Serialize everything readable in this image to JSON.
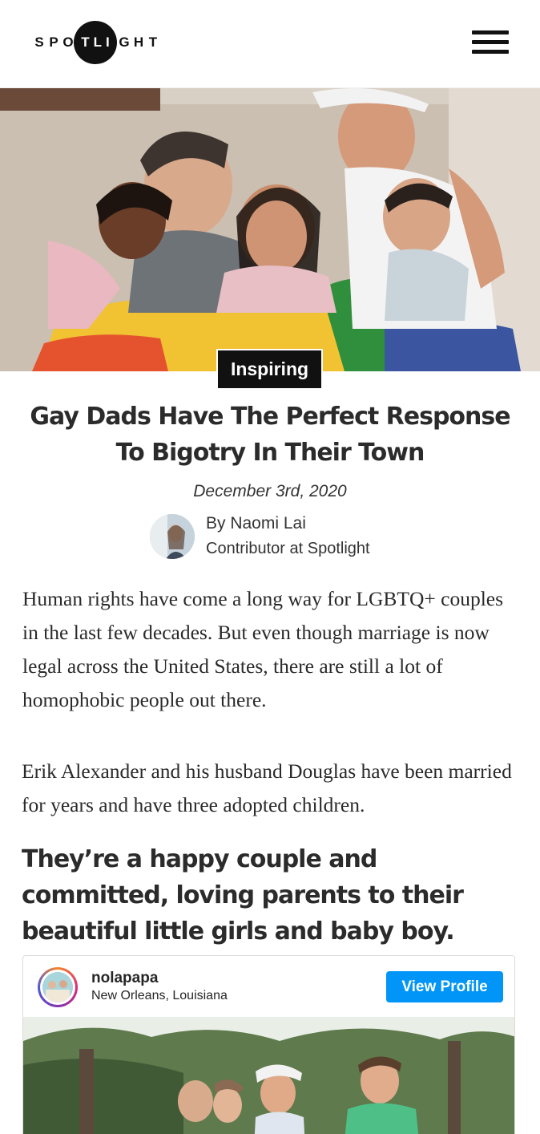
{
  "header": {
    "logo_letters": [
      "S",
      "P",
      "O"
    ],
    "logo_circle": "TLI",
    "logo_letters_after": [
      "G",
      "H",
      "T"
    ],
    "menu_icon": "hamburger-menu-icon"
  },
  "article": {
    "category": "Inspiring",
    "title": "Gay Dads Have The Perfect Response To Bigotry In Their Town",
    "date": "December 3rd, 2020",
    "author_name": "By Naomi Lai",
    "author_role": "Contributor at Spotlight",
    "paragraphs": [
      "Human rights have come a long way for LGBTQ+ couples in the last few decades. But even though marriage is now legal across the United States, there are still a lot of homophobic people out there.",
      "Erik Alexander and his husband Douglas have been married for years and have three adopted children."
    ],
    "subheading": "They’re a happy couple and committed, loving parents to their beautiful little girls and baby boy."
  },
  "instagram_embed": {
    "username": "nolapapa",
    "location": "New Orleans, Louisiana",
    "button_label": "View Profile",
    "button_color": "#0095f6"
  },
  "colors": {
    "category_bg": "#111111",
    "text": "#2b2b2b"
  }
}
